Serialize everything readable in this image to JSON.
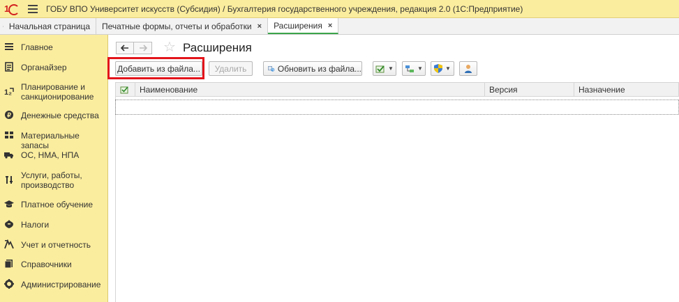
{
  "titlebar": {
    "title": "ГОБУ ВПО Университет искусств (Субсидия) / Бухгалтерия государственного учреждения, редакция 2.0  (1С:Предприятие)"
  },
  "tabs": [
    {
      "label": "Начальная страница",
      "icon": "home-icon"
    },
    {
      "label": "Печатные формы, отчеты и обработки",
      "close": "×"
    },
    {
      "label": "Расширения",
      "close": "×",
      "active": true
    }
  ],
  "sidebar": {
    "items": [
      {
        "label": "Главное",
        "icon": "list-icon"
      },
      {
        "label": "Органайзер",
        "icon": "organizer-icon"
      },
      {
        "label": "Планирование и санкционирование",
        "icon": "planning-icon"
      },
      {
        "label": "Денежные средства",
        "icon": "money-icon"
      },
      {
        "label": "Материальные запасы",
        "icon": "stock-icon"
      },
      {
        "label": "ОС, НМА, НПА",
        "icon": "truck-icon"
      },
      {
        "label": "Услуги, работы, производство",
        "icon": "services-icon"
      },
      {
        "label": "Платное обучение",
        "icon": "graduation-icon"
      },
      {
        "label": "Налоги",
        "icon": "tax-icon"
      },
      {
        "label": "Учет и отчетность",
        "icon": "report-icon"
      },
      {
        "label": "Справочники",
        "icon": "directory-icon"
      },
      {
        "label": "Администрирование",
        "icon": "gear-icon"
      }
    ]
  },
  "page": {
    "title": "Расширения"
  },
  "toolbar": {
    "add_from_file": "Добавить из файла...",
    "delete": "Удалить",
    "update_from_file": "Обновить из файла..."
  },
  "table": {
    "columns": [
      "Наименование",
      "Версия",
      "Назначение"
    ]
  },
  "colors": {
    "sidebar_bg": "#fbed9e",
    "highlight": "#e3141b",
    "active_tab": "#3aa54a"
  }
}
